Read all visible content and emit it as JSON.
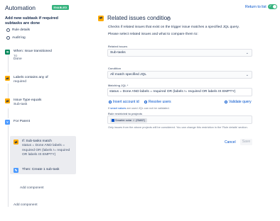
{
  "header": {
    "title": "Automation",
    "badge": "ENABLED",
    "return_label": "Return to list",
    "toggle_on": true
  },
  "rule": {
    "name": "Add new subtask if required subtasks are done",
    "links": [
      {
        "label": "Rule details",
        "icon": "info-icon"
      },
      {
        "label": "Audit log",
        "icon": "clock-icon"
      }
    ],
    "steps": {
      "trigger": {
        "label": "When: Issue transitioned",
        "to_label": "TO",
        "value": "Done"
      },
      "cond1": {
        "line1": "Labels contains any of",
        "line2": "required"
      },
      "cond2": {
        "line1": "Issue Type equals",
        "line2": "Sub-task"
      },
      "branch": {
        "label": "For Parent"
      },
      "if_cond": {
        "line1": "If: Sub-tasks match",
        "line2": "status = Done AND labels =",
        "line3": "required OR (labels != required",
        "line4": "OR labels IS EMPTY)"
      },
      "action": {
        "label": "Then: Create 1 sub-task"
      }
    },
    "add_component_inner": "Add component",
    "add_component_outer": "Add component"
  },
  "panel": {
    "title": "Related issues condition",
    "desc1": "Checks if related issues that exist on the trigger issue matches a specified JQL query.",
    "desc2": "Please select related issues and what to compare them to:",
    "related_label": "Related issues",
    "related_value": "Sub-tasks",
    "condition_label": "Condition",
    "condition_value": "All match specified JQL",
    "jql_label": "Matching JQL *",
    "jql_value": "status = Done AND labels = required OR (labels != required OR labels IS EMPTY)",
    "insert_account": "Insert account id",
    "resolve_users": "Resolve users",
    "validate_query": "Validate query",
    "smart_note_pre": "If ",
    "smart_note_link": "smart values",
    "smart_note_post": " are used JQL can not be validated.",
    "projects_label": "Rule restricted to projects",
    "project_chip": "Smarter solar ☆ (SMAT)",
    "note2": "Only issues from the above projects will be considered. You can change this restriction in the 'Rule details' section.",
    "cancel_label": "Cancel",
    "save_label": "Save"
  }
}
